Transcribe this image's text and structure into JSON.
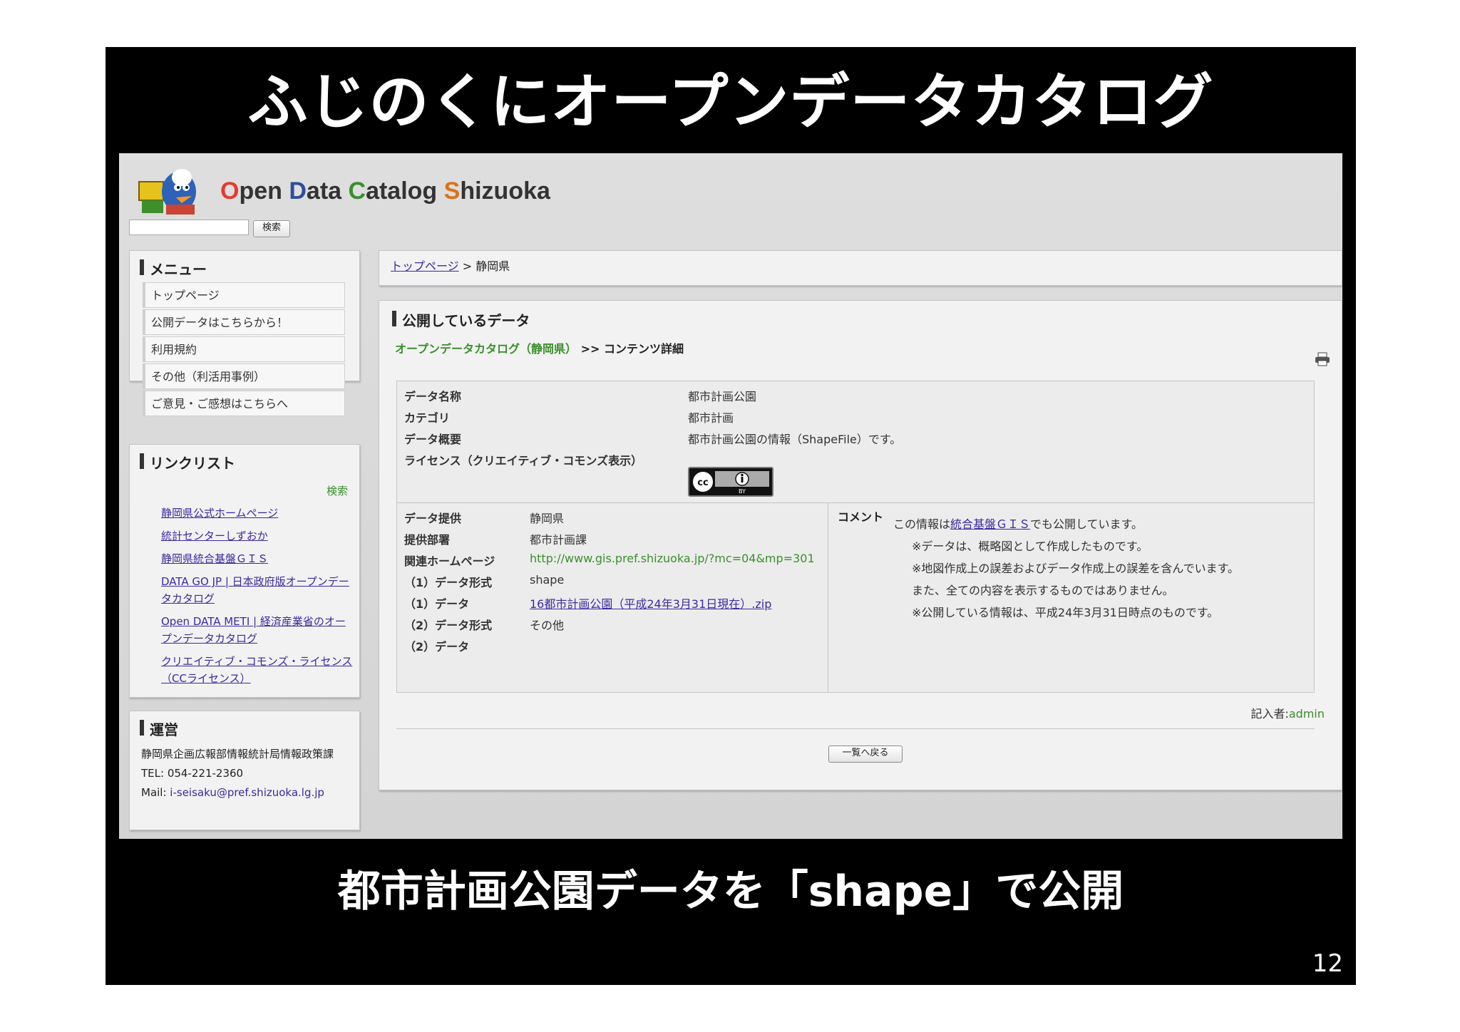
{
  "slide": {
    "title": "ふじのくにオープンデータカタログ",
    "caption": "都市計画公園データを「shape」で公開",
    "page_number": "12"
  },
  "header": {
    "brand": {
      "o": "O",
      "pen": "pen ",
      "d": "D",
      "ata": "ata ",
      "c": "C",
      "atalog": "atalog ",
      "s": "S",
      "hizuoka": "hizuoka"
    },
    "search_button": "検索",
    "search_value": ""
  },
  "menu": {
    "title": "メニュー",
    "items": [
      "トップページ",
      "公開データはこちらから！",
      "利用規約",
      "その他（利活用事例）",
      "ご意見・ご感想はこちらへ"
    ]
  },
  "links": {
    "title": "リンクリスト",
    "search": "検索",
    "items": [
      "静岡県公式ホームページ",
      "統計センターしずおか",
      "静岡県統合基盤ＧＩＳ",
      "DATA GO JP | 日本政府版オープンデータカタログ",
      "Open DATA METI | 経済産業省のオープンデータカタログ",
      "クリエイティブ・コモンズ・ライセンス（CCライセンス）"
    ]
  },
  "org": {
    "title": "運営",
    "name": "静岡県企画広報部情報統計局情報政策課",
    "tel": "TEL: 054-221-2360",
    "mail_label": "Mail: ",
    "mail": "i-seisaku@pref.shizuoka.lg.jp"
  },
  "breadcrumb": {
    "top": "トップページ",
    "sep": " > ",
    "current": "静岡県"
  },
  "data_panel": {
    "title": "公開しているデータ",
    "catalog_link": "オープンデータカタログ（静岡県）",
    "catalog_sep": " >> コンテンツ詳細",
    "fields": [
      {
        "label": "データ名称",
        "value": "都市計画公園"
      },
      {
        "label": "カテゴリ",
        "value": "都市計画"
      },
      {
        "label": "データ概要",
        "value": "都市計画公園の情報（ShapeFile）です。"
      },
      {
        "label": "ライセンス（クリエイティブ・コモンズ表示）",
        "value": ""
      }
    ],
    "cc_text": "BY",
    "details": [
      {
        "label": "データ提供",
        "value": "静岡県"
      },
      {
        "label": "提供部署",
        "value": "都市計画課"
      },
      {
        "label": "関連ホームページ",
        "value": "http://www.gis.pref.shizuoka.jp/?mc=04&mp=301"
      },
      {
        "label": "（1）データ形式",
        "value": "shape"
      },
      {
        "label": "（1）データ",
        "value": "16都市計画公園（平成24年3月31日現在）.zip"
      },
      {
        "label": "（2）データ形式",
        "value": "その他"
      },
      {
        "label": "（2）データ",
        "value": ""
      }
    ],
    "comment_label": "コメント",
    "comment": {
      "pre": "この情報は",
      "link": "統合基盤ＧＩＳ",
      "post": "でも公開しています。",
      "lines": [
        "※データは、概略図として作成したものです。",
        "※地図作成上の誤差およびデータ作成上の誤差を含んでいます。",
        "また、全ての内容を表示するものではありません。",
        "※公開している情報は、平成24年3月31日時点のものです。"
      ]
    },
    "author_label": "記入者:",
    "author": "admin",
    "back_button": "一覧へ戻る"
  },
  "colors": {
    "link": "#3b2aa0",
    "green": "#3a8f2d",
    "brand_o": "#e53b2c",
    "brand_d": "#2e4d9c",
    "brand_c": "#3a8f2d",
    "brand_s": "#d9731a"
  }
}
